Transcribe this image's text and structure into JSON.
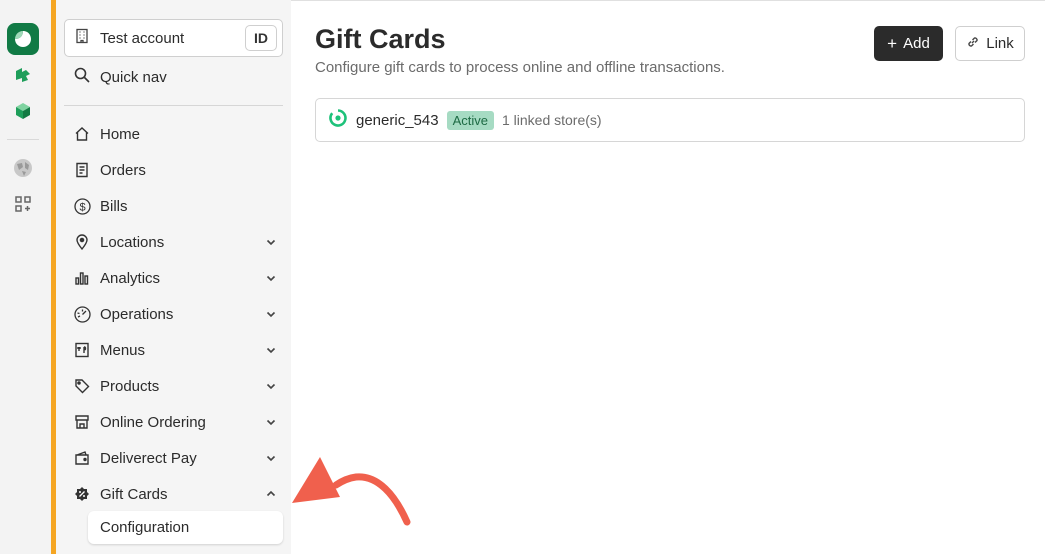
{
  "rail": {
    "icons": [
      "brand-logo-icon",
      "puzzle-icon",
      "cube-icon",
      "globe-icon",
      "apps-add-icon"
    ]
  },
  "account": {
    "label": "Test account",
    "badge": "ID"
  },
  "quicknav": {
    "label": "Quick nav"
  },
  "nav": {
    "items": [
      {
        "label": "Home",
        "icon": "home-icon",
        "expandable": false
      },
      {
        "label": "Orders",
        "icon": "receipt-icon",
        "expandable": false
      },
      {
        "label": "Bills",
        "icon": "dollar-icon",
        "expandable": false
      },
      {
        "label": "Locations",
        "icon": "location-pin-icon",
        "expandable": true
      },
      {
        "label": "Analytics",
        "icon": "bar-chart-icon",
        "expandable": true
      },
      {
        "label": "Operations",
        "icon": "dashboard-gauge-icon",
        "expandable": true
      },
      {
        "label": "Menus",
        "icon": "menu-book-icon",
        "expandable": true
      },
      {
        "label": "Products",
        "icon": "tag-icon",
        "expandable": true
      },
      {
        "label": "Online Ordering",
        "icon": "storefront-icon",
        "expandable": true
      },
      {
        "label": "Deliverect Pay",
        "icon": "wallet-icon",
        "expandable": true
      },
      {
        "label": "Gift Cards",
        "icon": "gift-badge-icon",
        "expandable": true,
        "expanded": true
      }
    ],
    "subitem": {
      "label": "Configuration"
    }
  },
  "main": {
    "title": "Gift Cards",
    "subtitle": "Configure gift cards to process online and offline transactions.",
    "add_label": "Add",
    "link_label": "Link",
    "card": {
      "name": "generic_543",
      "status": "Active",
      "stores": "1 linked store(s)"
    }
  },
  "colors": {
    "accent": "#f5a623",
    "brand": "#117a45",
    "active_badge_bg": "#a6dbc3",
    "annotation_arrow": "#f0604d"
  }
}
